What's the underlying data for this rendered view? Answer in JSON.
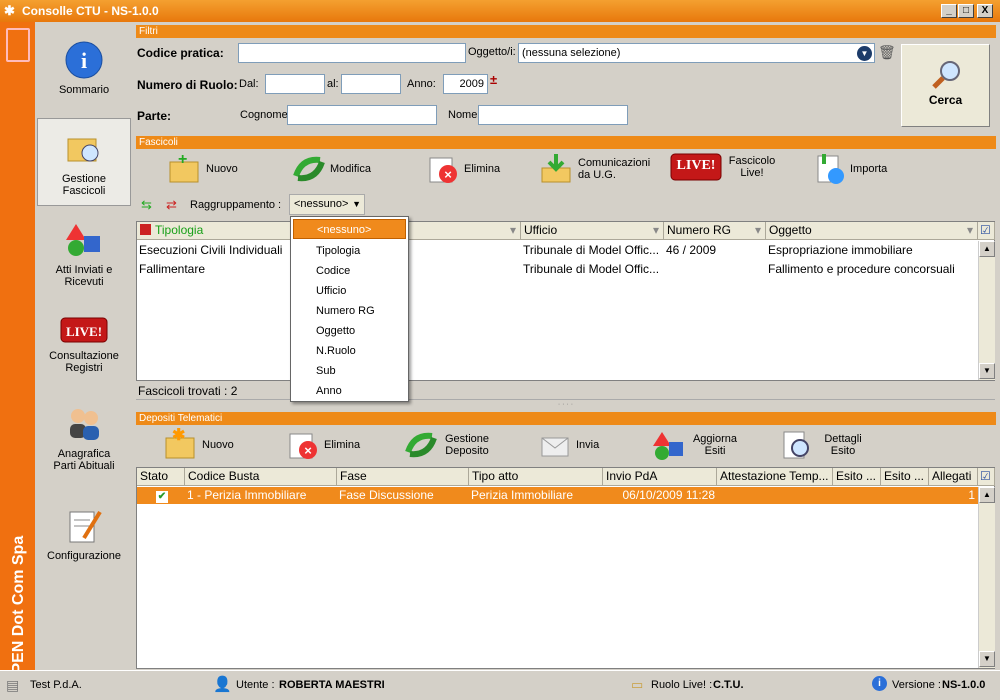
{
  "window": {
    "title": "Consolle CTU - NS-1.0.0",
    "buttons": [
      "_",
      "□",
      "X"
    ]
  },
  "brand": {
    "vertical_text": "OPEN Dot Com Spa"
  },
  "sidebar": {
    "items": [
      {
        "label": "Sommario",
        "icon": "info-icon"
      },
      {
        "label": "Gestione Fascicoli",
        "icon": "folder-search-icon",
        "selected": true
      },
      {
        "label": "Atti Inviati e Ricevuti",
        "icon": "shapes-icon"
      },
      {
        "label": "Consultazione Registri",
        "icon": "live-icon"
      },
      {
        "label": "Anagrafica Parti Abituali",
        "icon": "people-icon"
      },
      {
        "label": "Configurazione",
        "icon": "config-icon"
      }
    ]
  },
  "filtri": {
    "section": "Filtri",
    "codice_label": "Codice pratica:",
    "oggetto_label": "Oggetto/i:",
    "oggetto_value": "(nessuna selezione)",
    "ruolo_label": "Numero di Ruolo:",
    "dal_label": "Dal:",
    "al_label": "al:",
    "anno_label": "Anno:",
    "anno_value": "2009",
    "parte_label": "Parte:",
    "cognome_label": "Cognome",
    "nome_label": "Nome",
    "cerca": "Cerca"
  },
  "fascicoli": {
    "section": "Fascicoli",
    "toolbar": {
      "nuovo": "Nuovo",
      "modifica": "Modifica",
      "elimina": "Elimina",
      "comunicazioni": "Comunicazioni da U.G.",
      "fascicolo_live": "Fascicolo Live!",
      "importa": "Importa",
      "live_badge": "LIVE!"
    },
    "raggruppamento_label": "Raggruppamento :",
    "raggruppamento_value": "<nessuno>",
    "columns": [
      "Tipologia",
      "Ufficio",
      "Numero RG",
      "Oggetto"
    ],
    "rows": [
      {
        "tipologia": "Esecuzioni Civili Individuali",
        "ufficio": "Tribunale di Model Offic...",
        "numero_rg": "46 / 2009",
        "oggetto": "Espropriazione immobiliare"
      },
      {
        "tipologia": "Fallimentare",
        "ufficio": "Tribunale di Model Offic...",
        "numero_rg": "",
        "oggetto": "Fallimento e procedure concorsuali"
      }
    ],
    "found": "Fascicoli trovati :  2",
    "dropdown": [
      "<nessuno>",
      "Tipologia",
      "Codice",
      "Ufficio",
      "Numero RG",
      "Oggetto",
      "N.Ruolo",
      "Sub",
      "Anno"
    ]
  },
  "depositi": {
    "section": "Depositi Telematici",
    "toolbar": {
      "nuovo": "Nuovo",
      "elimina": "Elimina",
      "gestione": "Gestione Deposito",
      "invia": "Invia",
      "aggiorna": "Aggiorna Esiti",
      "dettagli": "Dettagli Esito"
    },
    "columns": [
      "Stato",
      "Codice Busta",
      "Fase",
      "Tipo atto",
      "Invio PdA",
      "Attestazione Temp...",
      "Esito ...",
      "Esito ...",
      "Allegati"
    ],
    "row": {
      "stato": "✔",
      "codice": "1 - Perizia Immobiliare",
      "fase": "Fase Discussione",
      "tipo": "Perizia Immobiliare",
      "invio": "06/10/2009 11:28",
      "allegati": "1"
    }
  },
  "status": {
    "test": "Test P.d.A.",
    "utente_label": "Utente :",
    "utente": "ROBERTA MAESTRI",
    "ruolo_label": "Ruolo Live! :",
    "ruolo": "C.T.U.",
    "versione_label": "Versione :",
    "versione": "NS-1.0.0"
  },
  "colors": {
    "accent": "#f07010",
    "selection": "#f08a1c"
  }
}
